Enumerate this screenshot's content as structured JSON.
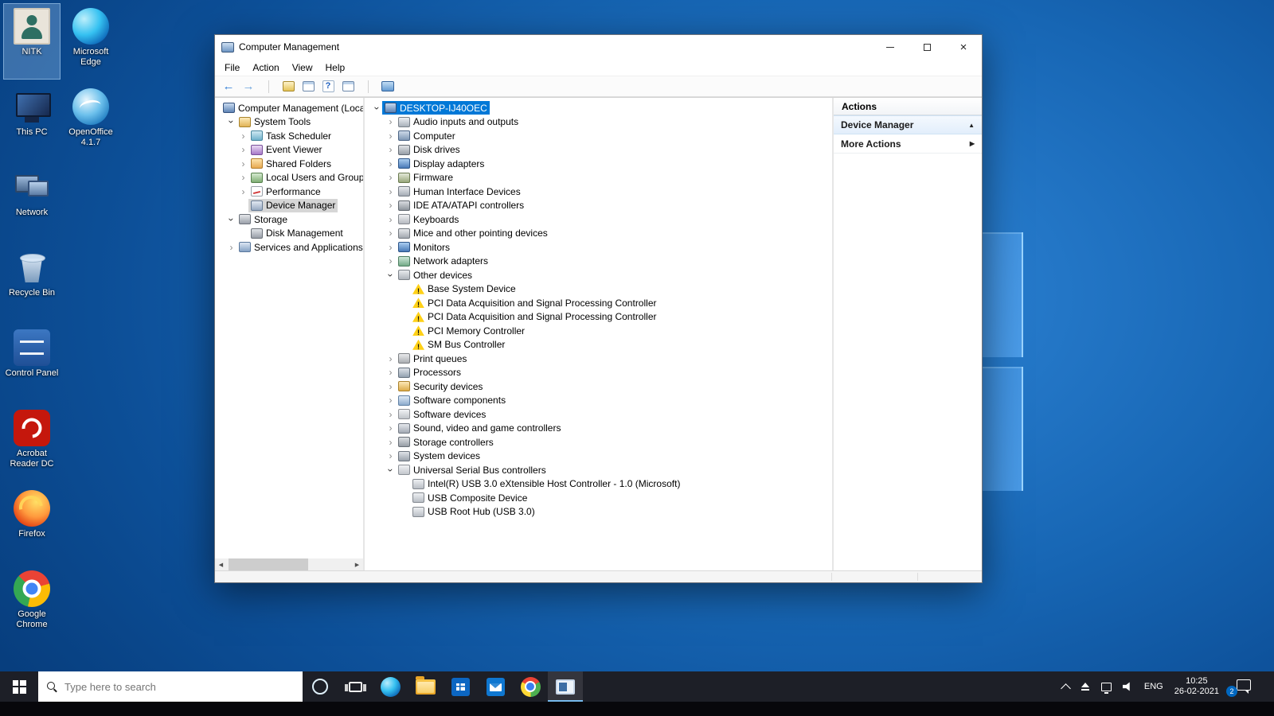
{
  "colors": {
    "accent": "#0078d7",
    "selection_blue": "#0078d7",
    "warning_yellow": "#ffd117",
    "taskbar_bg": "#1d1f27"
  },
  "desktop": {
    "column1": [
      {
        "label": "NITK",
        "icon": "nitk",
        "selected": true,
        "name": "desktop-icon-nitk"
      },
      {
        "label": "This PC",
        "icon": "thispc",
        "name": "desktop-icon-this-pc"
      },
      {
        "label": "Network",
        "icon": "network",
        "name": "desktop-icon-network"
      },
      {
        "label": "Recycle Bin",
        "icon": "recycle",
        "name": "desktop-icon-recycle-bin"
      },
      {
        "label": "Control Panel",
        "icon": "controlpanel",
        "name": "desktop-icon-control-panel"
      },
      {
        "label": "Acrobat Reader DC",
        "icon": "acrobat",
        "name": "desktop-icon-acrobat-reader"
      },
      {
        "label": "Firefox",
        "icon": "firefox",
        "name": "desktop-icon-firefox"
      },
      {
        "label": "Google Chrome",
        "icon": "chrome",
        "name": "desktop-icon-google-chrome"
      }
    ],
    "column2": [
      {
        "label": "Microsoft Edge",
        "icon": "edge",
        "name": "desktop-icon-microsoft-edge"
      },
      {
        "label": "OpenOffice 4.1.7",
        "icon": "openoffice",
        "name": "desktop-icon-openoffice"
      }
    ]
  },
  "window": {
    "title": "Computer Management",
    "menu": [
      {
        "label": "File",
        "name": "menu-file"
      },
      {
        "label": "Action",
        "name": "menu-action"
      },
      {
        "label": "View",
        "name": "menu-view"
      },
      {
        "label": "Help",
        "name": "menu-help"
      }
    ],
    "toolbar": [
      {
        "name": "back-button",
        "icon": "back"
      },
      {
        "name": "forward-button",
        "icon": "fwd"
      },
      {
        "name": "toolbar-separator",
        "icon": "sep"
      },
      {
        "name": "export-list-button",
        "icon": "export"
      },
      {
        "name": "console-tree-button",
        "icon": "win"
      },
      {
        "name": "help-button",
        "icon": "help"
      },
      {
        "name": "show-hide-button",
        "icon": "win"
      },
      {
        "name": "toolbar-separator",
        "icon": "sep"
      },
      {
        "name": "scan-hardware-button",
        "icon": "tscan"
      }
    ],
    "console_tree": [
      {
        "label": "Computer Management (Local)",
        "level": 0,
        "chevron": "hidden",
        "icon": "cmroot",
        "name": "tree-computer-management-root"
      },
      {
        "label": "System Tools",
        "level": 1,
        "chevron": "expanded",
        "icon": "systools",
        "name": "tree-system-tools"
      },
      {
        "label": "Task Scheduler",
        "level": 2,
        "chevron": "collapsed",
        "icon": "task",
        "name": "tree-task-scheduler"
      },
      {
        "label": "Event Viewer",
        "level": 2,
        "chevron": "collapsed",
        "icon": "event",
        "name": "tree-event-viewer"
      },
      {
        "label": "Shared Folders",
        "level": 2,
        "chevron": "collapsed",
        "icon": "shared",
        "name": "tree-shared-folders"
      },
      {
        "label": "Local Users and Groups",
        "level": 2,
        "chevron": "collapsed",
        "icon": "users",
        "name": "tree-local-users-and-groups"
      },
      {
        "label": "Performance",
        "level": 2,
        "chevron": "collapsed",
        "icon": "perf",
        "name": "tree-performance"
      },
      {
        "label": "Device Manager",
        "level": 2,
        "chevron": "none",
        "icon": "devmgr",
        "selected": true,
        "name": "tree-device-manager"
      },
      {
        "label": "Storage",
        "level": 1,
        "chevron": "expanded",
        "icon": "storage",
        "name": "tree-storage"
      },
      {
        "label": "Disk Management",
        "level": 2,
        "chevron": "none",
        "icon": "diskmgmt",
        "name": "tree-disk-management"
      },
      {
        "label": "Services and Applications",
        "level": 1,
        "chevron": "collapsed",
        "icon": "services",
        "name": "tree-services-and-applications"
      }
    ],
    "device_tree": [
      {
        "label": "DESKTOP-IJ40OEC",
        "level": 0,
        "chevron": "expanded",
        "icon": "computer",
        "selected": true,
        "name": "device-root-desktop-ij40oec"
      },
      {
        "label": "Audio inputs and outputs",
        "level": 1,
        "chevron": "collapsed",
        "icon": "audio"
      },
      {
        "label": "Computer",
        "level": 1,
        "chevron": "collapsed",
        "icon": "pc"
      },
      {
        "label": "Disk drives",
        "level": 1,
        "chevron": "collapsed",
        "icon": "disk"
      },
      {
        "label": "Display adapters",
        "level": 1,
        "chevron": "collapsed",
        "icon": "display"
      },
      {
        "label": "Firmware",
        "level": 1,
        "chevron": "collapsed",
        "icon": "firmware"
      },
      {
        "label": "Human Interface Devices",
        "level": 1,
        "chevron": "collapsed",
        "icon": "hid"
      },
      {
        "label": "IDE ATA/ATAPI controllers",
        "level": 1,
        "chevron": "collapsed",
        "icon": "ide"
      },
      {
        "label": "Keyboards",
        "level": 1,
        "chevron": "collapsed",
        "icon": "keyboard"
      },
      {
        "label": "Mice and other pointing devices",
        "level": 1,
        "chevron": "collapsed",
        "icon": "mouse"
      },
      {
        "label": "Monitors",
        "level": 1,
        "chevron": "collapsed",
        "icon": "monitor"
      },
      {
        "label": "Network adapters",
        "level": 1,
        "chevron": "collapsed",
        "icon": "netadapter"
      },
      {
        "label": "Other devices",
        "level": 1,
        "chevron": "expanded",
        "icon": "other",
        "name": "device-category-other-devices"
      },
      {
        "label": "Base System Device",
        "level": 2,
        "chevron": "none",
        "icon": "warn",
        "name": "device-base-system-device"
      },
      {
        "label": "PCI Data Acquisition and Signal Processing Controller",
        "level": 2,
        "chevron": "none",
        "icon": "warn",
        "name": "device-pci-data-acquisition-1"
      },
      {
        "label": "PCI Data Acquisition and Signal Processing Controller",
        "level": 2,
        "chevron": "none",
        "icon": "warn",
        "name": "device-pci-data-acquisition-2"
      },
      {
        "label": "PCI Memory Controller",
        "level": 2,
        "chevron": "none",
        "icon": "warn",
        "name": "device-pci-memory-controller"
      },
      {
        "label": "SM Bus Controller",
        "level": 2,
        "chevron": "none",
        "icon": "warn",
        "name": "device-sm-bus-controller"
      },
      {
        "label": "Print queues",
        "level": 1,
        "chevron": "collapsed",
        "icon": "print"
      },
      {
        "label": "Processors",
        "level": 1,
        "chevron": "collapsed",
        "icon": "cpu"
      },
      {
        "label": "Security devices",
        "level": 1,
        "chevron": "collapsed",
        "icon": "security"
      },
      {
        "label": "Software components",
        "level": 1,
        "chevron": "collapsed",
        "icon": "softcomp"
      },
      {
        "label": "Software devices",
        "level": 1,
        "chevron": "collapsed",
        "icon": "softdev"
      },
      {
        "label": "Sound, video and game controllers",
        "level": 1,
        "chevron": "collapsed",
        "icon": "sound"
      },
      {
        "label": "Storage controllers",
        "level": 1,
        "chevron": "collapsed",
        "icon": "storctl"
      },
      {
        "label": "System devices",
        "level": 1,
        "chevron": "collapsed",
        "icon": "sysdev"
      },
      {
        "label": "Universal Serial Bus controllers",
        "level": 1,
        "chevron": "expanded",
        "icon": "usb",
        "name": "device-category-usb-controllers"
      },
      {
        "label": "Intel(R) USB 3.0 eXtensible Host Controller - 1.0 (Microsoft)",
        "level": 2,
        "chevron": "none",
        "icon": "usbdev",
        "name": "device-intel-usb3-host-controller"
      },
      {
        "label": "USB Composite Device",
        "level": 2,
        "chevron": "none",
        "icon": "usbdev",
        "name": "device-usb-composite-device"
      },
      {
        "label": "USB Root Hub (USB 3.0)",
        "level": 2,
        "chevron": "none",
        "icon": "usbdev",
        "name": "device-usb-root-hub"
      }
    ],
    "actions": {
      "title": "Actions",
      "items": [
        {
          "label": "Device Manager",
          "glyph": "▲",
          "selected": true,
          "name": "actions-device-manager"
        },
        {
          "label": "More Actions",
          "glyph": "▶",
          "name": "actions-more-actions"
        }
      ]
    }
  },
  "taskbar": {
    "search_placeholder": "Type here to search",
    "apps": [
      {
        "name": "taskbar-cortana",
        "icon": "cortana"
      },
      {
        "name": "taskbar-task-view",
        "icon": "taskview"
      },
      {
        "name": "taskbar-edge",
        "icon": "tbedge"
      },
      {
        "name": "taskbar-file-explorer",
        "icon": "explorer"
      },
      {
        "name": "taskbar-store",
        "icon": "store"
      },
      {
        "name": "taskbar-mail",
        "icon": "mail"
      },
      {
        "name": "taskbar-chrome",
        "icon": "tbchrome"
      },
      {
        "name": "taskbar-computer-management",
        "icon": "cm",
        "active": true
      }
    ],
    "tray": [
      {
        "name": "hidden-icons-chevron",
        "icon": "trchev"
      },
      {
        "name": "safely-remove-hardware-icon",
        "icon": "treject"
      },
      {
        "name": "network-icon",
        "icon": "trnet"
      },
      {
        "name": "volume-icon",
        "icon": "trvol"
      },
      {
        "name": "language-indicator",
        "label": "ENG"
      }
    ],
    "time": "10:25",
    "date": "26-02-2021",
    "action_center_badge": "2"
  }
}
